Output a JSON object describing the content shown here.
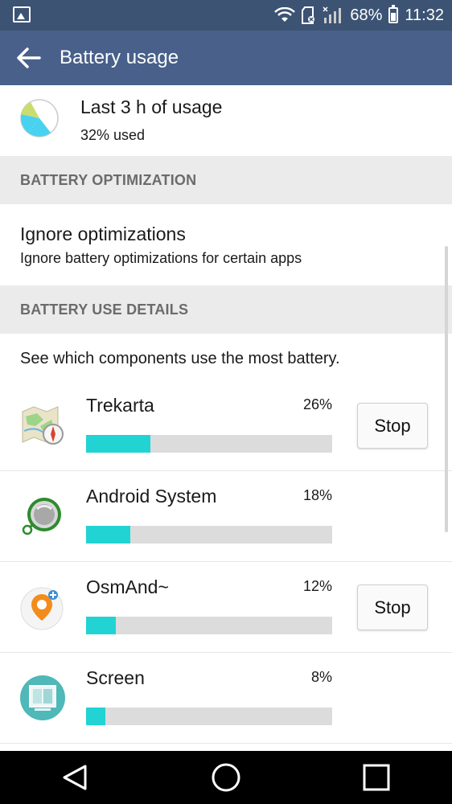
{
  "status_bar": {
    "battery_percent": "68%",
    "time": "11:32",
    "icons": [
      "image-icon",
      "wifi-icon",
      "sd-card-icon",
      "signal-icon",
      "battery-icon"
    ]
  },
  "app_bar": {
    "title": "Battery usage",
    "back_icon": "arrow-back-icon"
  },
  "usage_summary": {
    "title": "Last 3 h of usage",
    "subtitle": "32% used"
  },
  "sections": {
    "optimization_header": "BATTERY OPTIMIZATION",
    "details_header": "BATTERY USE DETAILS"
  },
  "ignore_optimizations": {
    "title": "Ignore optimizations",
    "subtitle": "Ignore battery optimizations for certain apps"
  },
  "details_description": "See which components use the most battery.",
  "apps": [
    {
      "name": "Trekarta",
      "percent_label": "26%",
      "fraction": 0.26,
      "stop_label": "Stop",
      "icon": "trekarta-map-icon"
    },
    {
      "name": "Android System",
      "percent_label": "18%",
      "fraction": 0.18,
      "icon": "android-system-icon"
    },
    {
      "name": "OsmAnd~",
      "percent_label": "12%",
      "fraction": 0.12,
      "stop_label": "Stop",
      "icon": "osmand-icon"
    },
    {
      "name": "Screen",
      "percent_label": "8%",
      "fraction": 0.08,
      "icon": "screen-icon"
    }
  ],
  "colors": {
    "status_bar": "#3c5373",
    "app_bar": "#48608a",
    "bar_fill": "#22d3d3",
    "bar_track": "#dcdcdc",
    "section_bg": "#ebebeb"
  },
  "nav_bar": {
    "buttons": [
      "back-triangle-icon",
      "home-circle-icon",
      "recents-square-icon"
    ]
  }
}
